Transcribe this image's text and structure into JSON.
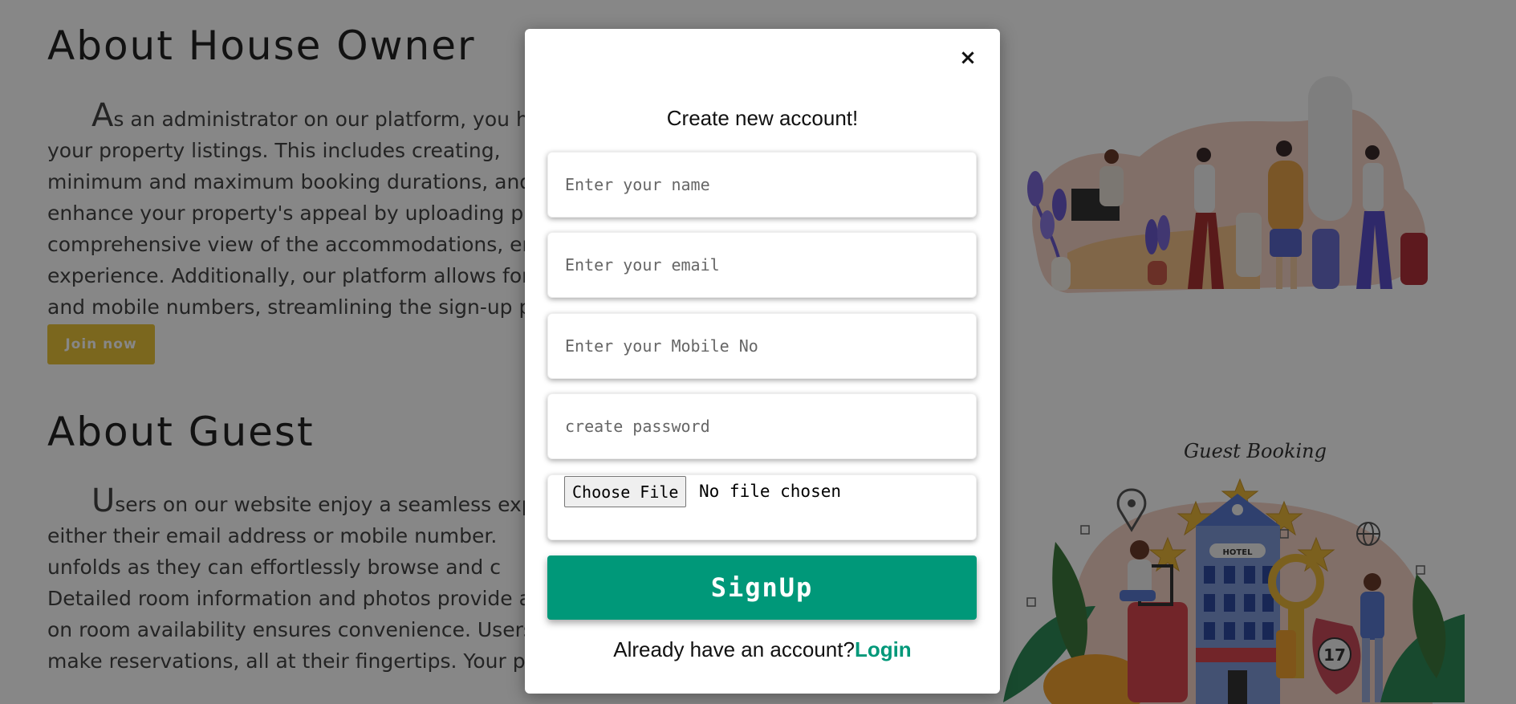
{
  "page": {
    "owner_section": {
      "title": "About House Owner",
      "dropcap": "A",
      "lines": [
        "s an administrator on our platform, you h",
        "your property listings. This includes creating,",
        "minimum and maximum booking durations, and",
        "enhance your property's appeal by uploading p",
        "comprehensive view of the accommodations, en",
        "experience. Additionally, our platform allows for",
        "and mobile numbers, streamlining the sign-up pr"
      ],
      "join_label": "Join now"
    },
    "guest_section": {
      "title": "About Guest",
      "dropcap": "U",
      "lines": [
        "sers on our website enjoy a seamless exp",
        "either their email address or mobile number.",
        "unfolds as they can effortlessly browse and c",
        "Detailed room information and photos provide a",
        "on room availability ensures convenience. Users",
        "make reservations, all at their fingertips. Your per"
      ]
    },
    "guest_booking_caption": "Guest Booking",
    "hotel_sign": "HOTEL",
    "key_number": "17"
  },
  "modal": {
    "close_icon": "×",
    "title": "Create new account!",
    "fields": {
      "name_placeholder": "Enter your name",
      "email_placeholder": "Enter your email",
      "mobile_placeholder": "Enter your Mobile No",
      "password_placeholder": "create password"
    },
    "file": {
      "button_label": "Choose File",
      "status": "No file chosen"
    },
    "signup_label": "SignUp",
    "login_prompt": "Already have an account?",
    "login_link": "Login"
  },
  "colors": {
    "accent": "#009879",
    "join_button": "#e8c23a",
    "overlay": "rgba(0,0,0,0.47)"
  }
}
